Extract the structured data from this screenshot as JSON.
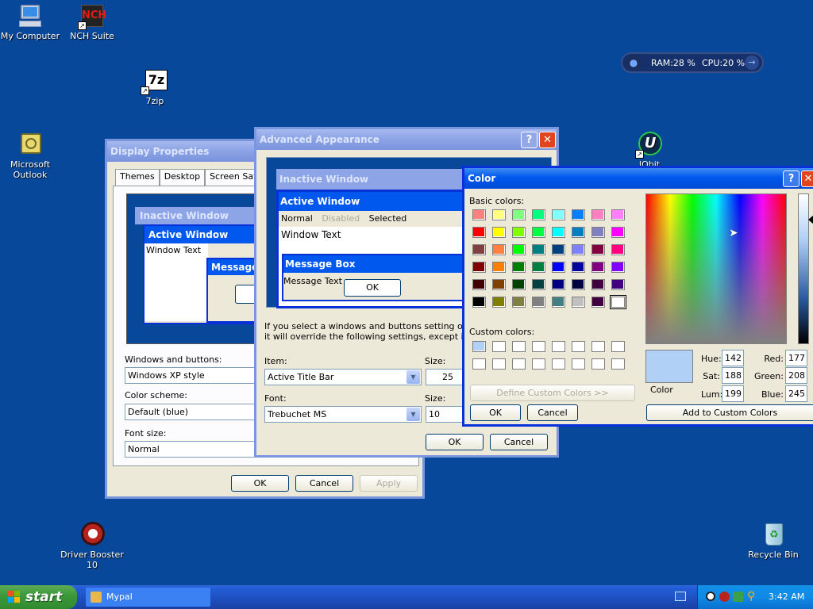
{
  "desktop": {
    "icons": [
      {
        "label": "My Computer"
      },
      {
        "label": "NCH Suite"
      },
      {
        "label": "7zip"
      },
      {
        "label": "Microsoft\nOutlook"
      },
      {
        "label": "IObit"
      },
      {
        "label": "Driver Booster\n10"
      },
      {
        "label": "Recycle Bin"
      }
    ]
  },
  "widget": {
    "ram": "RAM:28 %",
    "cpu": "CPU:20 %"
  },
  "display_properties": {
    "title": "Display Properties",
    "tabs": [
      "Themes",
      "Desktop",
      "Screen Saver"
    ],
    "preview": {
      "inactive": "Inactive Window",
      "active": "Active Window",
      "window_text": "Window Text",
      "message": "Message"
    },
    "windows_buttons_label": "Windows and buttons:",
    "windows_buttons_value": "Windows XP style",
    "color_scheme_label": "Color scheme:",
    "color_scheme_value": "Default (blue)",
    "font_size_label": "Font size:",
    "font_size_value": "Normal",
    "ok": "OK",
    "cancel": "Cancel",
    "apply": "Apply"
  },
  "advanced_appearance": {
    "title": "Advanced Appearance",
    "preview": {
      "inactive": "Inactive Window",
      "active": "Active Window",
      "menu_normal": "Normal",
      "menu_disabled": "Disabled",
      "menu_selected": "Selected",
      "window_text": "Window Text",
      "message_box": "Message Box",
      "message_text": "Message Text",
      "ok": "OK"
    },
    "info_line1": "If you select a windows and buttons setting other th",
    "info_line2": "it will override the following settings, except in some",
    "item_label": "Item:",
    "item_value": "Active Title Bar",
    "size_label": "Size:",
    "size_value": "25",
    "font_label": "Font:",
    "font_value": "Trebuchet MS",
    "font_size_label": "Size:",
    "font_size_value": "10",
    "ok": "OK",
    "cancel": "Cancel"
  },
  "color_dialog": {
    "title": "Color",
    "basic_colors_label": "Basic colors:",
    "basic_colors": [
      "#ff8080",
      "#ffff80",
      "#80ff80",
      "#00ff80",
      "#80ffff",
      "#0080ff",
      "#ff80c0",
      "#ff80ff",
      "#ff0000",
      "#ffff00",
      "#80ff00",
      "#00ff40",
      "#00ffff",
      "#0080c0",
      "#8080c0",
      "#ff00ff",
      "#804040",
      "#ff8040",
      "#00ff00",
      "#008080",
      "#004080",
      "#8080ff",
      "#800040",
      "#ff0080",
      "#800000",
      "#ff8000",
      "#008000",
      "#008040",
      "#0000ff",
      "#0000a0",
      "#800080",
      "#8000ff",
      "#400000",
      "#804000",
      "#004000",
      "#004040",
      "#000080",
      "#000040",
      "#400040",
      "#400080",
      "#000000",
      "#808000",
      "#808040",
      "#808080",
      "#408080",
      "#c0c0c0",
      "#400040",
      "#ffffff"
    ],
    "custom_colors_label": "Custom colors:",
    "custom_colors": [
      "#b1d0f5",
      "#ffffff",
      "#ffffff",
      "#ffffff",
      "#ffffff",
      "#ffffff",
      "#ffffff",
      "#ffffff",
      "#ffffff",
      "#ffffff",
      "#ffffff",
      "#ffffff",
      "#ffffff",
      "#ffffff",
      "#ffffff",
      "#ffffff"
    ],
    "define_custom": "Define Custom Colors >>",
    "ok": "OK",
    "cancel": "Cancel",
    "color_solid_label": "Color",
    "hue_label": "Hue:",
    "hue": "142",
    "sat_label": "Sat:",
    "sat": "188",
    "lum_label": "Lum:",
    "lum": "199",
    "red_label": "Red:",
    "red": "177",
    "green_label": "Green:",
    "green": "208",
    "blue_label": "Blue:",
    "blue": "245",
    "add_custom": "Add to Custom Colors",
    "selected_color": "#b1d0f5"
  },
  "taskbar": {
    "start": "start",
    "task": "Mypal",
    "clock": "3:42 AM"
  }
}
